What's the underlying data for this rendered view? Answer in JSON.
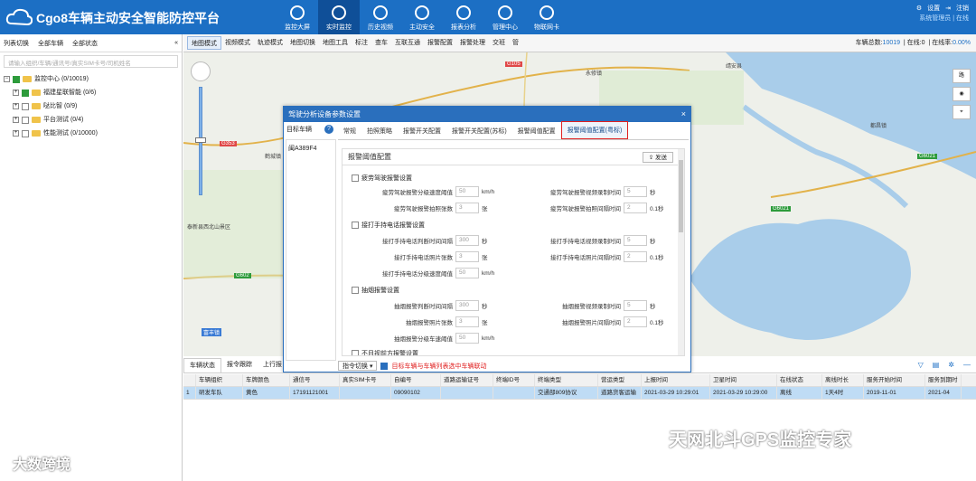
{
  "header": {
    "title": "Cgo8车辆主动安全智能防控平台",
    "nav": [
      "监控大屏",
      "实时监控",
      "历史视频",
      "主动安全",
      "报表分析",
      "管理中心",
      "物联网卡"
    ],
    "active_nav": 1,
    "settings": "设置",
    "logout": "注销",
    "admin": "系统管理员 | 在线"
  },
  "left": {
    "tools": [
      "列表切换",
      "全部车辆",
      "全部状态"
    ],
    "search_placeholder": "请输入组织/车辆/通讯号/真实SIM卡号/司机姓名",
    "tree": [
      {
        "label": "监控中心 (0/10019)",
        "level": 0
      },
      {
        "label": "福建星联智能 (0/6)",
        "level": 1,
        "checked": true
      },
      {
        "label": "哒比智 (0/9)",
        "level": 1
      },
      {
        "label": "平台测试 (0/4)",
        "level": 1
      },
      {
        "label": "性能测试 (0/10000)",
        "level": 1
      }
    ]
  },
  "toolbar": {
    "items": [
      "地图模式",
      "视频模式",
      "轨迹模式",
      "地图切换",
      "地图工具",
      "标注",
      "查车",
      "互联互通",
      "报警配置",
      "报警处理",
      "交班",
      "管"
    ],
    "stats": {
      "total_label": "车辆总数:",
      "total": "10019",
      "online_label": "在线:",
      "online": "0",
      "rate_label": "在线率:",
      "rate": "0.00%"
    }
  },
  "map": {
    "labels": [
      "G105",
      "G105",
      "G6021",
      "G6021",
      "G353",
      "G602",
      "G602",
      "永修镇",
      "靖安县",
      "高安市",
      "鹤城镇",
      "泰新县西北山景区",
      "都昌镇",
      "富丰镇"
    ]
  },
  "dialog": {
    "title": "驾驶分析设备参数设置",
    "close": "×",
    "target_label": "目标车辆",
    "help": "?",
    "vehicle": "闽A389F4",
    "tabs": [
      "常规",
      "拍照策略",
      "报警开关配置",
      "报警开关配置(苏标)",
      "报警阈值配置",
      "报警阈值配置(粤标)"
    ],
    "active_tab": 5,
    "panel_title": "报警阈值配置",
    "send": "发送",
    "sections": [
      {
        "title": "疲劳驾驶报警设置",
        "fields": [
          {
            "label": "疲劳驾驶报警分级速度阈值",
            "value": "50",
            "unit": "km/h"
          },
          {
            "label": "疲劳驾驶报警视频录制时间",
            "value": "5",
            "unit": "秒"
          },
          {
            "label": "疲劳驾驶报警拍照张数",
            "value": "3",
            "unit": "张"
          },
          {
            "label": "疲劳驾驶报警拍照间隔时间",
            "value": "2",
            "unit": "0.1秒"
          }
        ]
      },
      {
        "title": "接打手持电话报警设置",
        "fields": [
          {
            "label": "接打手持电话判断时间间隔",
            "value": "300",
            "unit": "秒"
          },
          {
            "label": "接打手持电话视频录制时间",
            "value": "5",
            "unit": "秒"
          },
          {
            "label": "接打手持电话照片张数",
            "value": "3",
            "unit": "张"
          },
          {
            "label": "接打手持电话照片间隔时间",
            "value": "2",
            "unit": "0.1秒"
          },
          {
            "label": "接打手持电话分级速度阈值",
            "value": "50",
            "unit": "km/h"
          }
        ]
      },
      {
        "title": "抽烟报警设置",
        "fields": [
          {
            "label": "抽烟报警判断时间间隔",
            "value": "300",
            "unit": "秒"
          },
          {
            "label": "抽烟报警视频录制时间",
            "value": "5",
            "unit": "秒"
          },
          {
            "label": "抽烟报警照片张数",
            "value": "3",
            "unit": "张"
          },
          {
            "label": "抽烟报警照片间隔时间",
            "value": "2",
            "unit": "0.1秒"
          },
          {
            "label": "抽烟报警分级车速阈值",
            "value": "50",
            "unit": "km/h"
          }
        ]
      },
      {
        "title": "不目视前方报警设置",
        "fields": []
      }
    ],
    "footer": {
      "command": "指令切换",
      "note": "目标车辆与车辆列表选中车辆联动"
    }
  },
  "bottom": {
    "tabs": [
      "车辆状态",
      "报令跟踪",
      "上行报"
    ],
    "columns": [
      "",
      "车辆组织",
      "车牌颜色",
      "通信号",
      "真实SIM卡号",
      "自编号",
      "道路运输证号",
      "终端ID号",
      "终端类型",
      "营运类型",
      "上报时间",
      "卫星时间",
      "在线状态",
      "离线时长",
      "服务开始时间",
      "服务到期时"
    ],
    "rows": [
      [
        "1",
        "研发车队",
        "黄色",
        "17191121001",
        "",
        "09090102",
        "",
        "",
        "交通部809协议",
        "道路货客运输",
        "2021-03-29 10:29:01",
        "2021-03-29 10:29:00",
        "离线",
        "1天4时",
        "2019-11-01",
        "2021-04"
      ]
    ]
  },
  "watermarks": {
    "left": "大数跨境",
    "right": "天网北斗GPS监控专家"
  },
  "colors": {
    "brand": "#1c6fc4",
    "highlight": "#e02020"
  }
}
